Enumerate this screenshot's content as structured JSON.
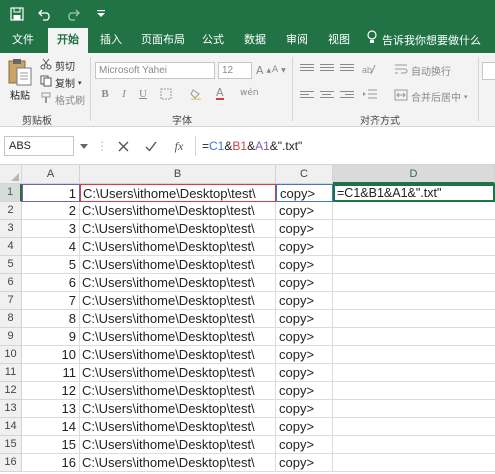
{
  "quick_access": {
    "icons": [
      "save-icon",
      "undo-icon",
      "redo-icon",
      "customize-icon"
    ]
  },
  "ribbon_tabs": [
    {
      "label": "文件",
      "active": false
    },
    {
      "label": "开始",
      "active": true
    },
    {
      "label": "插入",
      "active": false
    },
    {
      "label": "页面布局",
      "active": false
    },
    {
      "label": "公式",
      "active": false
    },
    {
      "label": "数据",
      "active": false
    },
    {
      "label": "审阅",
      "active": false
    },
    {
      "label": "视图",
      "active": false
    }
  ],
  "tell_me": "告诉我你想要做什么",
  "clipboard": {
    "paste": "粘贴",
    "cut": "剪切",
    "copy": "复制",
    "format_painter": "格式刷",
    "group": "剪贴板"
  },
  "font": {
    "name": "Microsoft Yahei",
    "size": "12",
    "bold": "B",
    "italic": "I",
    "underline": "U",
    "group": "字体"
  },
  "alignment": {
    "wrap_text": "自动换行",
    "merge_center": "合并后居中",
    "group": "对齐方式"
  },
  "formula_bar": {
    "name_box": "ABS",
    "fx": "fx",
    "formula_parts": [
      "=",
      "C1",
      "&",
      "B1",
      "&",
      "A1",
      "&\".txt\""
    ]
  },
  "columns": [
    "A",
    "B",
    "C",
    "D"
  ],
  "rows": [
    {
      "num": "1",
      "a": "1",
      "b": "C:\\Users\\ithome\\Desktop\\test\\",
      "c": "copy>",
      "d": "=C1&B1&A1&\".txt\""
    },
    {
      "num": "2",
      "a": "2",
      "b": "C:\\Users\\ithome\\Desktop\\test\\",
      "c": "copy>",
      "d": ""
    },
    {
      "num": "3",
      "a": "3",
      "b": "C:\\Users\\ithome\\Desktop\\test\\",
      "c": "copy>",
      "d": ""
    },
    {
      "num": "4",
      "a": "4",
      "b": "C:\\Users\\ithome\\Desktop\\test\\",
      "c": "copy>",
      "d": ""
    },
    {
      "num": "5",
      "a": "5",
      "b": "C:\\Users\\ithome\\Desktop\\test\\",
      "c": "copy>",
      "d": ""
    },
    {
      "num": "6",
      "a": "6",
      "b": "C:\\Users\\ithome\\Desktop\\test\\",
      "c": "copy>",
      "d": ""
    },
    {
      "num": "7",
      "a": "7",
      "b": "C:\\Users\\ithome\\Desktop\\test\\",
      "c": "copy>",
      "d": ""
    },
    {
      "num": "8",
      "a": "8",
      "b": "C:\\Users\\ithome\\Desktop\\test\\",
      "c": "copy>",
      "d": ""
    },
    {
      "num": "9",
      "a": "9",
      "b": "C:\\Users\\ithome\\Desktop\\test\\",
      "c": "copy>",
      "d": ""
    },
    {
      "num": "10",
      "a": "10",
      "b": "C:\\Users\\ithome\\Desktop\\test\\",
      "c": "copy>",
      "d": ""
    },
    {
      "num": "11",
      "a": "11",
      "b": "C:\\Users\\ithome\\Desktop\\test\\",
      "c": "copy>",
      "d": ""
    },
    {
      "num": "12",
      "a": "12",
      "b": "C:\\Users\\ithome\\Desktop\\test\\",
      "c": "copy>",
      "d": ""
    },
    {
      "num": "13",
      "a": "13",
      "b": "C:\\Users\\ithome\\Desktop\\test\\",
      "c": "copy>",
      "d": ""
    },
    {
      "num": "14",
      "a": "14",
      "b": "C:\\Users\\ithome\\Desktop\\test\\",
      "c": "copy>",
      "d": ""
    },
    {
      "num": "15",
      "a": "15",
      "b": "C:\\Users\\ithome\\Desktop\\test\\",
      "c": "copy>",
      "d": ""
    },
    {
      "num": "16",
      "a": "16",
      "b": "C:\\Users\\ithome\\Desktop\\test\\",
      "c": "copy>",
      "d": ""
    }
  ],
  "colors": {
    "brand": "#217346",
    "ref_c": "#3a78c9",
    "ref_b": "#d04040",
    "ref_a": "#7b5ea8"
  }
}
